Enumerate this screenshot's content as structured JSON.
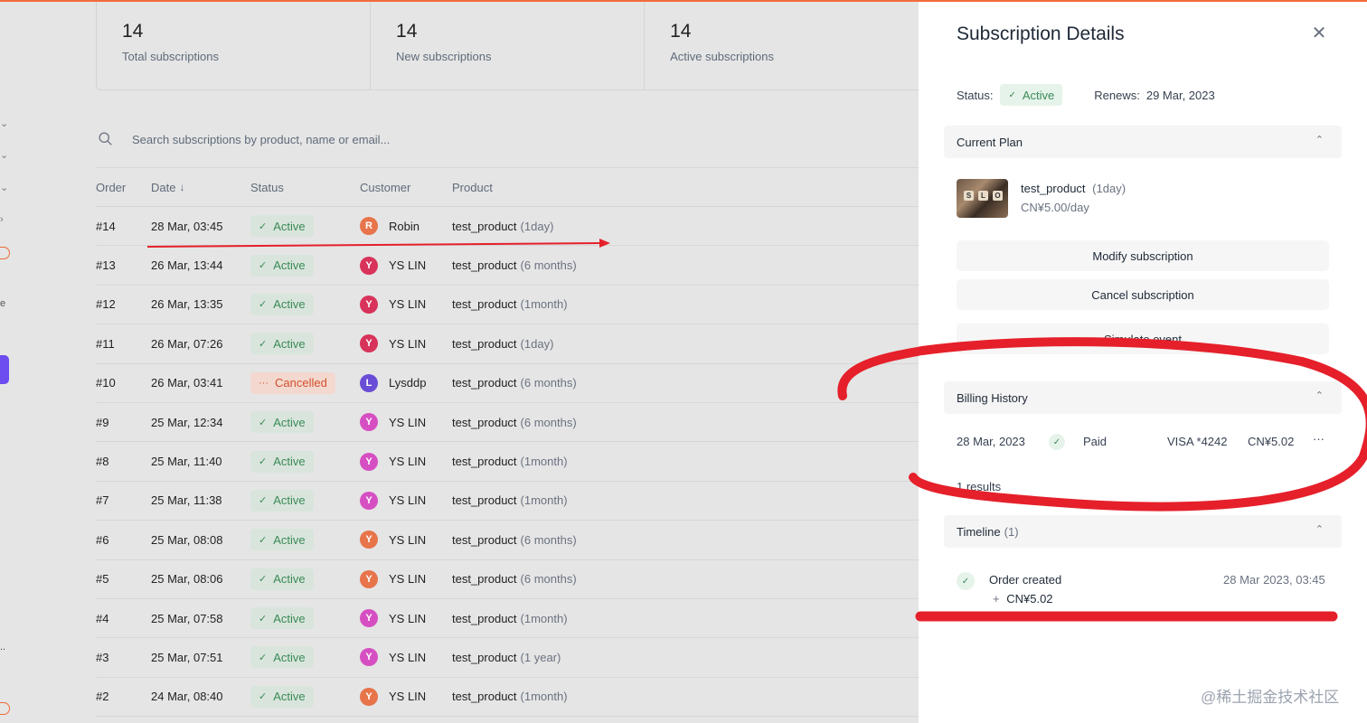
{
  "stats": [
    {
      "value": "14",
      "label": "Total subscriptions"
    },
    {
      "value": "14",
      "label": "New subscriptions"
    },
    {
      "value": "14",
      "label": "Active subscriptions"
    }
  ],
  "search": {
    "placeholder": "Search subscriptions by product, name or email..."
  },
  "table": {
    "headers": {
      "order": "Order",
      "date": "Date",
      "status": "Status",
      "customer": "Customer",
      "product": "Product"
    },
    "rows": [
      {
        "order": "#14",
        "date": "28 Mar, 03:45",
        "status": "Active",
        "initial": "R",
        "avatar_color": "#e7744a",
        "customer": "Robin",
        "product": "test_product",
        "term": "(1day)"
      },
      {
        "order": "#13",
        "date": "26 Mar, 13:44",
        "status": "Active",
        "initial": "Y",
        "avatar_color": "#d8335a",
        "customer": "YS LIN",
        "product": "test_product",
        "term": "(6 months)"
      },
      {
        "order": "#12",
        "date": "26 Mar, 13:35",
        "status": "Active",
        "initial": "Y",
        "avatar_color": "#d8335a",
        "customer": "YS LIN",
        "product": "test_product",
        "term": "(1month)"
      },
      {
        "order": "#11",
        "date": "26 Mar, 07:26",
        "status": "Active",
        "initial": "Y",
        "avatar_color": "#d8335a",
        "customer": "YS LIN",
        "product": "test_product",
        "term": "(1day)"
      },
      {
        "order": "#10",
        "date": "26 Mar, 03:41",
        "status": "Cancelled",
        "initial": "L",
        "avatar_color": "#6a4dd6",
        "customer": "Lysddp",
        "product": "test_product",
        "term": "(6 months)"
      },
      {
        "order": "#9",
        "date": "25 Mar, 12:34",
        "status": "Active",
        "initial": "Y",
        "avatar_color": "#d64fc2",
        "customer": "YS LIN",
        "product": "test_product",
        "term": "(6 months)"
      },
      {
        "order": "#8",
        "date": "25 Mar, 11:40",
        "status": "Active",
        "initial": "Y",
        "avatar_color": "#d64fc2",
        "customer": "YS LIN",
        "product": "test_product",
        "term": "(1month)"
      },
      {
        "order": "#7",
        "date": "25 Mar, 11:38",
        "status": "Active",
        "initial": "Y",
        "avatar_color": "#d64fc2",
        "customer": "YS LIN",
        "product": "test_product",
        "term": "(1month)"
      },
      {
        "order": "#6",
        "date": "25 Mar, 08:08",
        "status": "Active",
        "initial": "Y",
        "avatar_color": "#e7744a",
        "customer": "YS LIN",
        "product": "test_product",
        "term": "(6 months)"
      },
      {
        "order": "#5",
        "date": "25 Mar, 08:06",
        "status": "Active",
        "initial": "Y",
        "avatar_color": "#e7744a",
        "customer": "YS LIN",
        "product": "test_product",
        "term": "(6 months)"
      },
      {
        "order": "#4",
        "date": "25 Mar, 07:58",
        "status": "Active",
        "initial": "Y",
        "avatar_color": "#d64fc2",
        "customer": "YS LIN",
        "product": "test_product",
        "term": "(1month)"
      },
      {
        "order": "#3",
        "date": "25 Mar, 07:51",
        "status": "Active",
        "initial": "Y",
        "avatar_color": "#d64fc2",
        "customer": "YS LIN",
        "product": "test_product",
        "term": "(1 year)"
      },
      {
        "order": "#2",
        "date": "24 Mar, 08:40",
        "status": "Active",
        "initial": "Y",
        "avatar_color": "#e7744a",
        "customer": "YS LIN",
        "product": "test_product",
        "term": "(1month)"
      }
    ]
  },
  "drawer": {
    "title": "Subscription Details",
    "status_label": "Status:",
    "status_value": "Active",
    "renews_label": "Renews:",
    "renews_value": "29 Mar, 2023",
    "current_plan": {
      "heading": "Current Plan",
      "product": "test_product",
      "term": "(1day)",
      "price": "CN¥5.00/day"
    },
    "buttons": {
      "modify": "Modify subscription",
      "cancel": "Cancel subscription",
      "simulate": "Simulate event"
    },
    "billing": {
      "heading": "Billing History",
      "date": "28 Mar, 2023",
      "status": "Paid",
      "card": "VISA *4242",
      "amount": "CN¥5.02",
      "more": "···",
      "results": "1 results"
    },
    "timeline": {
      "heading": "Timeline",
      "count": "(1)",
      "event": "Order created",
      "time": "28 Mar 2023, 03:45",
      "amount": "CN¥5.02"
    }
  },
  "watermark": "@稀土掘金技术社区",
  "colors": {
    "accent": "#f26b3a",
    "active_green": "#3a8a57",
    "cancel_red": "#d2502d",
    "annotation_red": "#e5202a"
  }
}
